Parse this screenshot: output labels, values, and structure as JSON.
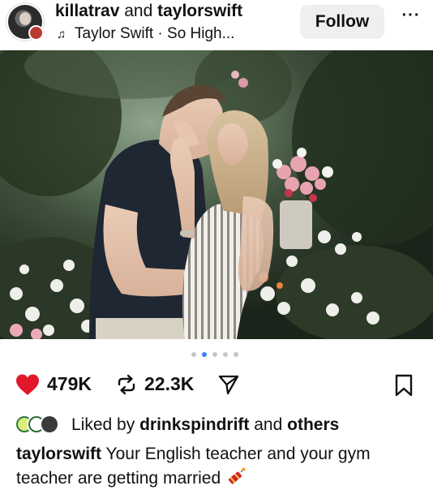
{
  "header": {
    "author": "killatrav",
    "conjunction": "and",
    "coauthor": "taylorswift",
    "audio_label": "Taylor Swift · So High...",
    "follow_label": "Follow",
    "more_label": "···"
  },
  "carousel": {
    "slide_count": 5,
    "active_index": 1
  },
  "actions": {
    "likes": "479K",
    "reposts": "22.3K"
  },
  "liked_by": {
    "prefix": "Liked by",
    "user": "drinkspindrift",
    "joiner": "and",
    "others": "others"
  },
  "caption": {
    "username": "taylorswift",
    "text": "Your English teacher and your gym teacher are getting married"
  },
  "colors": {
    "heart": "#e0182a",
    "accent_dot": "#3b82f6",
    "follow_bg": "#efeff2"
  },
  "icons": [
    "music-note-icon",
    "heart-icon",
    "repost-icon",
    "share-icon",
    "save-icon",
    "mute-icon",
    "firecracker-icon"
  ]
}
